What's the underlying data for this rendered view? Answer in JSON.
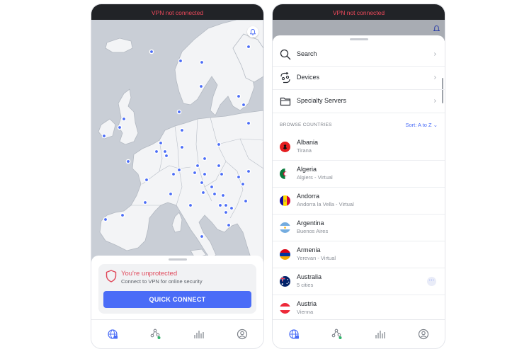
{
  "status": {
    "text": "VPN not connected"
  },
  "left_screen": {
    "protection": {
      "title": "You're unprotected",
      "subtitle": "Connect to VPN for online security",
      "button_label": "QUICK CONNECT"
    },
    "icons": [
      "notification-bell-icon",
      "shield-icon"
    ]
  },
  "right_screen": {
    "menu": [
      {
        "label": "Search",
        "icon": "search-icon"
      },
      {
        "label": "Devices",
        "icon": "devices-icon"
      },
      {
        "label": "Specialty Servers",
        "icon": "folder-icon"
      }
    ],
    "browse_label": "BROWSE COUNTRIES",
    "sort_label": "Sort: A to Z",
    "countries": [
      {
        "name": "Albania",
        "sub": "Tirana",
        "flag": "flag-albania"
      },
      {
        "name": "Algeria",
        "sub": "Algiers - Virtual",
        "flag": "flag-algeria"
      },
      {
        "name": "Andorra",
        "sub": "Andorra la Vella - Virtual",
        "flag": "flag-andorra"
      },
      {
        "name": "Argentina",
        "sub": "Buenos Aires",
        "flag": "flag-argentina"
      },
      {
        "name": "Armenia",
        "sub": "Yerevan - Virtual",
        "flag": "flag-armenia"
      },
      {
        "name": "Australia",
        "sub": "5 cities",
        "flag": "flag-australia",
        "more": "···"
      },
      {
        "name": "Austria",
        "sub": "Vienna",
        "flag": "flag-austria"
      }
    ]
  },
  "tabbar": [
    "globe-icon",
    "meshnet-icon",
    "stats-icon",
    "profile-icon"
  ],
  "colors": {
    "accent": "#4a6cf7",
    "warning": "#e0485a",
    "status_bar": "#212327",
    "status_text": "#f0495b"
  }
}
